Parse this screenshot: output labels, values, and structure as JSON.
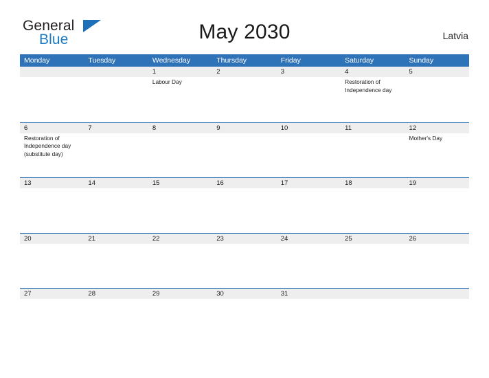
{
  "brand": {
    "line1": "General",
    "line2": "Blue",
    "flag_icon": "flag-triangle-icon",
    "accent_color": "#1b79c3"
  },
  "header": {
    "title": "May 2030",
    "region": "Latvia"
  },
  "colors": {
    "header_blue": "#2e72b8",
    "row_band_gray": "#eeeeee",
    "text": "#1a1a1a"
  },
  "calendar": {
    "weekdays": [
      "Monday",
      "Tuesday",
      "Wednesday",
      "Thursday",
      "Friday",
      "Saturday",
      "Sunday"
    ],
    "weeks": [
      [
        {
          "day": "",
          "events": []
        },
        {
          "day": "",
          "events": []
        },
        {
          "day": "1",
          "events": [
            "Labour Day"
          ]
        },
        {
          "day": "2",
          "events": []
        },
        {
          "day": "3",
          "events": []
        },
        {
          "day": "4",
          "events": [
            "Restoration of Independence day"
          ]
        },
        {
          "day": "5",
          "events": []
        }
      ],
      [
        {
          "day": "6",
          "events": [
            "Restoration of Independence day (substitute day)"
          ]
        },
        {
          "day": "7",
          "events": []
        },
        {
          "day": "8",
          "events": []
        },
        {
          "day": "9",
          "events": []
        },
        {
          "day": "10",
          "events": []
        },
        {
          "day": "11",
          "events": []
        },
        {
          "day": "12",
          "events": [
            "Mother's Day"
          ]
        }
      ],
      [
        {
          "day": "13",
          "events": []
        },
        {
          "day": "14",
          "events": []
        },
        {
          "day": "15",
          "events": []
        },
        {
          "day": "16",
          "events": []
        },
        {
          "day": "17",
          "events": []
        },
        {
          "day": "18",
          "events": []
        },
        {
          "day": "19",
          "events": []
        }
      ],
      [
        {
          "day": "20",
          "events": []
        },
        {
          "day": "21",
          "events": []
        },
        {
          "day": "22",
          "events": []
        },
        {
          "day": "23",
          "events": []
        },
        {
          "day": "24",
          "events": []
        },
        {
          "day": "25",
          "events": []
        },
        {
          "day": "26",
          "events": []
        }
      ],
      [
        {
          "day": "27",
          "events": []
        },
        {
          "day": "28",
          "events": []
        },
        {
          "day": "29",
          "events": []
        },
        {
          "day": "30",
          "events": []
        },
        {
          "day": "31",
          "events": []
        },
        {
          "day": "",
          "events": []
        },
        {
          "day": "",
          "events": []
        }
      ]
    ]
  }
}
